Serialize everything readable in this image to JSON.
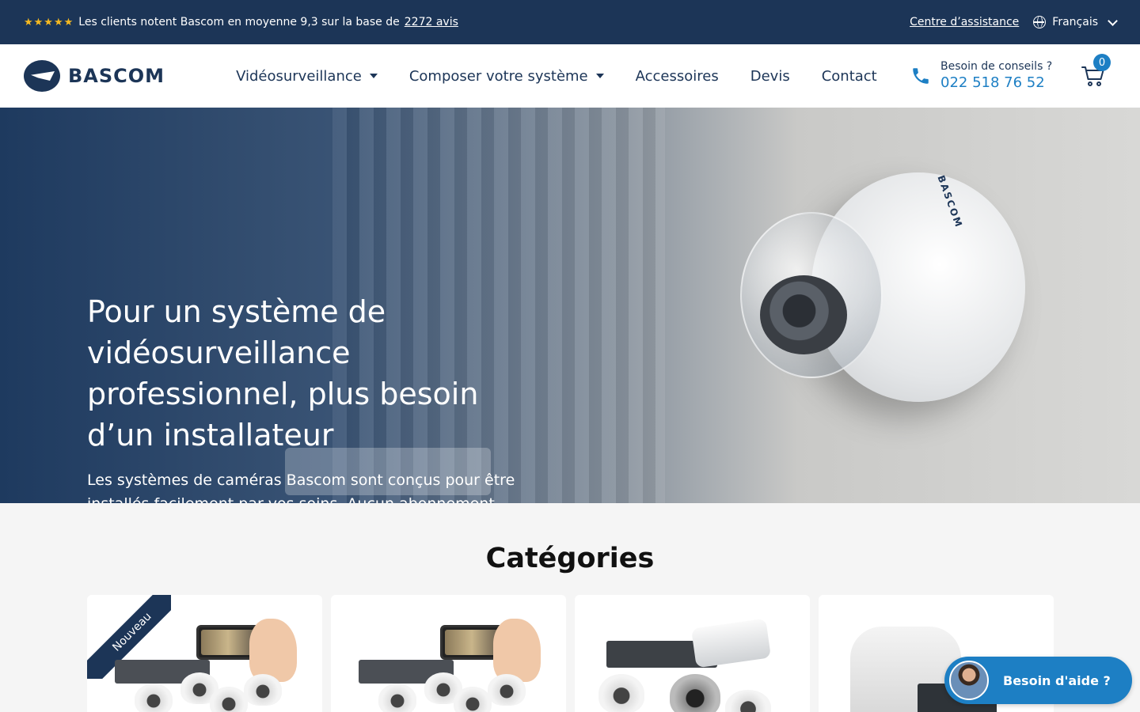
{
  "topbar": {
    "stars": "★★★★★",
    "rating_text": "Les clients notent Bascom en moyenne 9,3 sur la base de",
    "rating_link": "2272 avis",
    "help_center": "Centre d’assistance",
    "language": "Français"
  },
  "header": {
    "logo_text": "BASCOM",
    "nav": [
      {
        "label": "Vidéosurveillance",
        "has_dropdown": true
      },
      {
        "label": "Composer votre système",
        "has_dropdown": true
      },
      {
        "label": "Accessoires",
        "has_dropdown": false
      },
      {
        "label": "Devis",
        "has_dropdown": false
      },
      {
        "label": "Contact",
        "has_dropdown": false
      }
    ],
    "advice_label": "Besoin de conseils ?",
    "phone": "022 518 76 52",
    "cart_count": "0"
  },
  "hero": {
    "title": "Pour un système de vidéosurveillance professionnel, plus besoin d’un installateur",
    "subtitle": "Les systèmes de caméras Bascom sont conçus pour être installés facilement par vos soins. Aucun abonnement mensuel, et vous gardez le contrôle total.",
    "camera_brand": "BASCOM"
  },
  "categories": {
    "title": "Catégories",
    "new_badge": "Nouveau"
  },
  "help_widget": {
    "label": "Besoin d'aide ?"
  },
  "colors": {
    "navy": "#1c3557",
    "accent_blue": "#1d7fc4",
    "star": "#f5b921"
  }
}
